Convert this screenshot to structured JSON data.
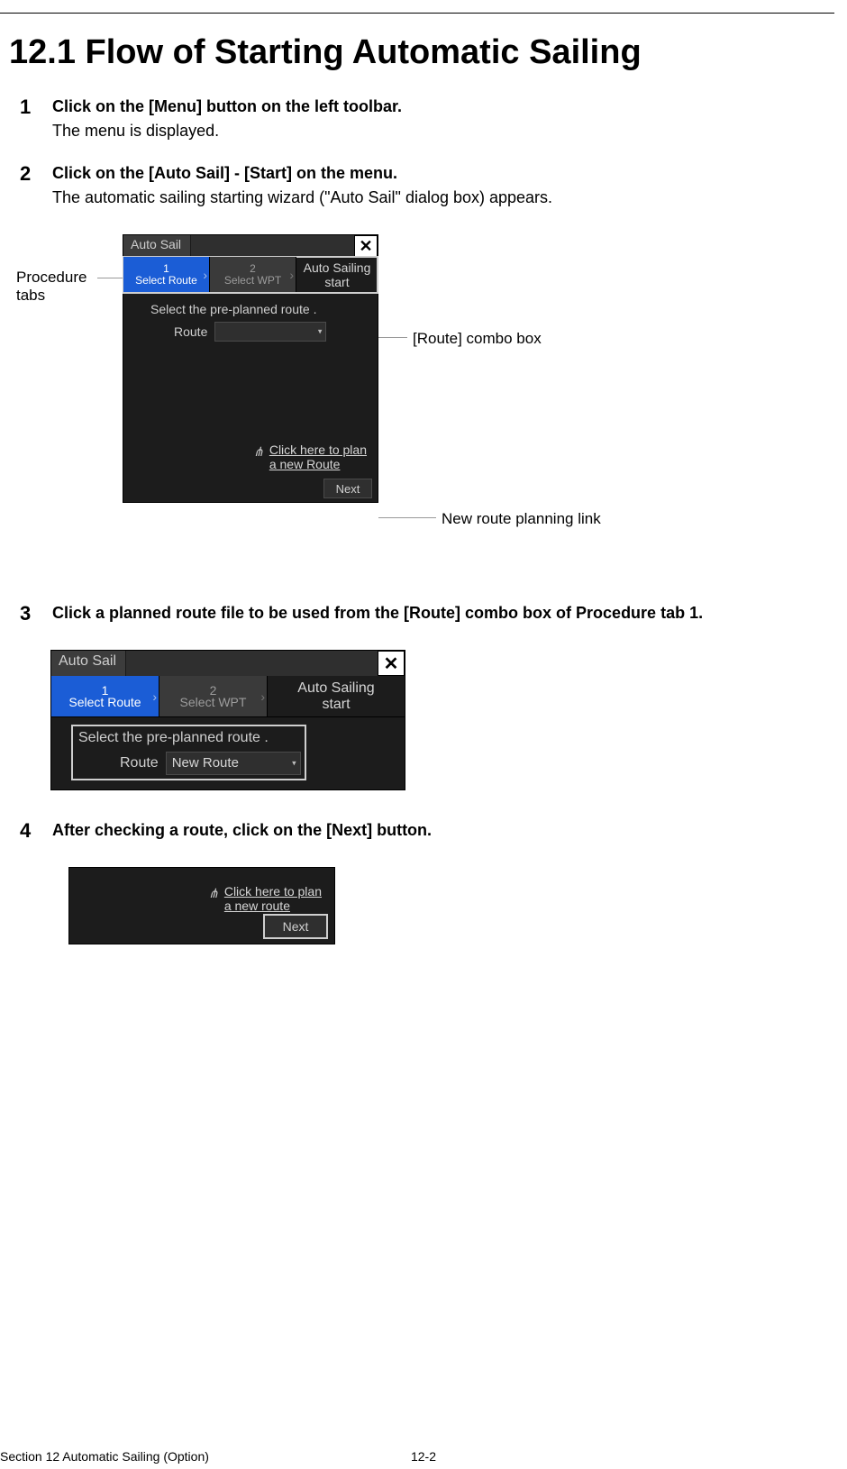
{
  "title": "12.1   Flow of Starting Automatic Sailing",
  "steps": {
    "s1": {
      "num": "1",
      "bold": "Click on the [Menu] button on the left toolbar.",
      "text": "The menu is displayed."
    },
    "s2": {
      "num": "2",
      "bold": "Click on the [Auto Sail] - [Start] on the menu.",
      "text": "The automatic sailing starting wizard (\"Auto Sail\" dialog box) appears."
    },
    "s3": {
      "num": "3",
      "bold": "Click a planned route file to be used from the [Route] combo box of Procedure tab 1."
    },
    "s4": {
      "num": "4",
      "bold": "After checking a route, click on the [Next] button."
    }
  },
  "annot": {
    "tabs_label_line1": "Procedure",
    "tabs_label_line2": "tabs",
    "combo_label": "[Route] combo box",
    "link_label": "New route planning link"
  },
  "dlg": {
    "title": "Auto Sail",
    "close": "✕",
    "tab1_num": "1",
    "tab1_label": "Select Route",
    "tab2_num": "2",
    "tab2_label": "Select WPT",
    "right_text_line1": "Auto Sailing",
    "right_text_line2": "start",
    "prompt": "Select the pre-planned route .",
    "route_label": "Route",
    "combo_empty": "",
    "combo_selected": "New Route",
    "plan_link_line1": "Click here to plan",
    "plan_link_line2_a": "a new Route",
    "plan_link_line2_b": "a new route",
    "next": "Next"
  },
  "footer": {
    "left": "Section 12    Automatic Sailing (Option)",
    "center": "12-2"
  }
}
